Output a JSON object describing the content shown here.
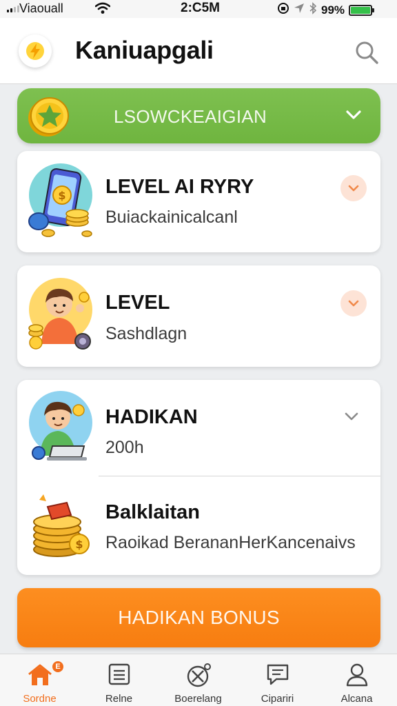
{
  "status_bar": {
    "carrier": "Viaouall",
    "time": "2:C5M",
    "battery_text": "99%"
  },
  "header": {
    "title": "Kaniuapgali",
    "logo_icon": "lightning-icon",
    "search_icon": "search-icon"
  },
  "level_dropdown": {
    "label": "LSOWCKEAIGIAN",
    "icon": "star-coin-icon"
  },
  "items": [
    {
      "title": "LEVEL AI RYRY",
      "subtitle": "Buiackainicalcanl",
      "icon": "phone-coins-icon"
    },
    {
      "title": "LEVEL",
      "subtitle": "Sashdlagn",
      "icon": "boy-coins-icon"
    },
    {
      "title": "HADIKAN",
      "subtitle": "200h",
      "icon": "boy-laptop-icon"
    },
    {
      "title": "Balklaitan",
      "subtitle": "Raoikad BerananHerKancenaivs",
      "icon": "coin-stack-icon"
    }
  ],
  "bonus_button": {
    "label": "HADIKAN BONUS"
  },
  "tabs": [
    {
      "label": "Sordne",
      "icon": "home-icon",
      "active": true,
      "badge": "E"
    },
    {
      "label": "Relne",
      "icon": "list-icon",
      "active": false
    },
    {
      "label": "Boerelang",
      "icon": "tools-icon",
      "active": false
    },
    {
      "label": "Cipariri",
      "icon": "chat-icon",
      "active": false
    },
    {
      "label": "Alcana",
      "icon": "profile-icon",
      "active": false
    }
  ],
  "colors": {
    "green": "#74b845",
    "orange": "#f77d10",
    "accent": "#f26e1d"
  }
}
